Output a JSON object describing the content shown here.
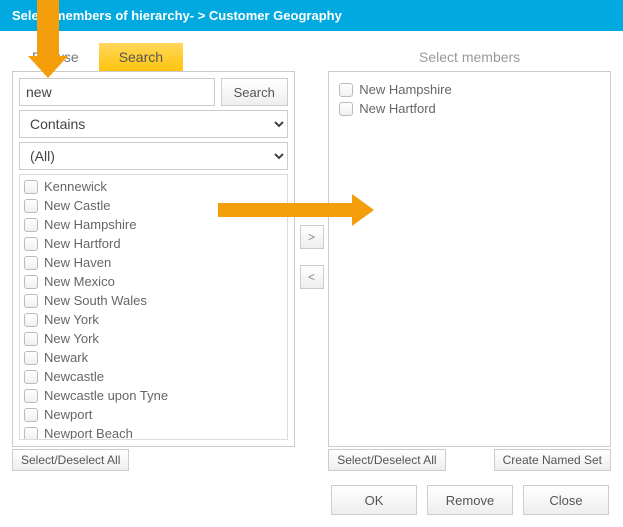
{
  "header": {
    "title": "Select members of hierarchy- > Customer Geography"
  },
  "tabs": {
    "browse": "Browse",
    "search": "Search"
  },
  "right_title": "Select members",
  "search": {
    "value": "new",
    "button": "Search",
    "match_mode": "Contains",
    "scope": "(All)"
  },
  "results": [
    "Kennewick",
    "New Castle",
    "New Hampshire",
    "New Hartford",
    "New Haven",
    "New Mexico",
    "New South Wales",
    "New York",
    "New York",
    "Newark",
    "Newcastle",
    "Newcastle upon Tyne",
    "Newport",
    "Newport Beach"
  ],
  "selected": [
    "New Hampshire",
    "New Hartford"
  ],
  "buttons": {
    "move_right": ">",
    "move_left": "<",
    "select_deselect": "Select/Deselect All",
    "create_named_set": "Create Named Set",
    "ok": "OK",
    "remove": "Remove",
    "close": "Close"
  }
}
